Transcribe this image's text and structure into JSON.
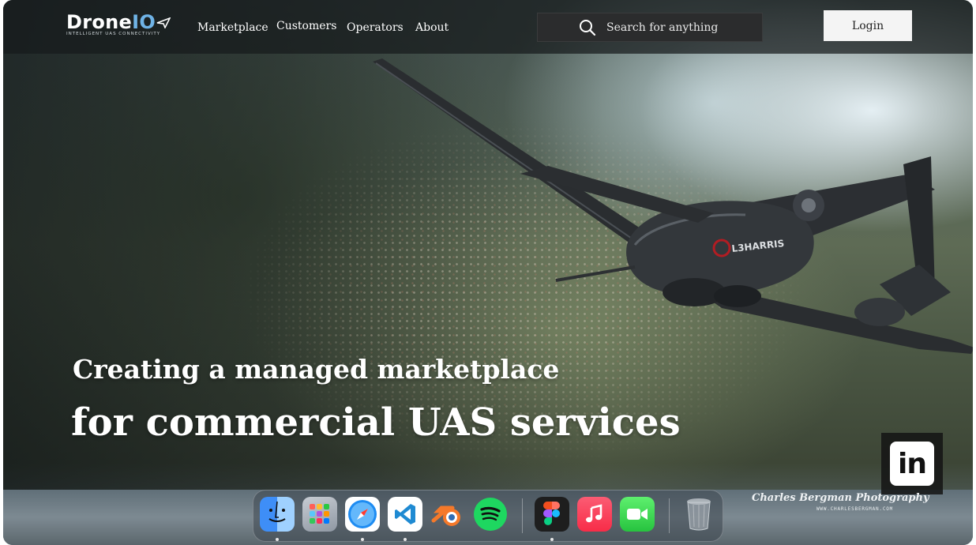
{
  "brand": {
    "name_main": "Drone",
    "name_accent": "IO",
    "tagline": "INTELLIGENT UAS CONNECTIVITY"
  },
  "nav": {
    "links": [
      "Marketplace",
      "Customers",
      "Operators",
      "About"
    ],
    "search_placeholder": "Search for anything",
    "login_label": "Login"
  },
  "hero": {
    "line1": "Creating a managed marketplace",
    "line2": "for commercial UAS services",
    "drone_marking": "L3HARRIS"
  },
  "social": {
    "linkedin_label": "in"
  },
  "photo_credit": {
    "name": "Charles Bergman Photography",
    "url": "WWW.CHARLESBERGMAN.COM"
  },
  "dock": {
    "apps": [
      "finder-icon",
      "launchpad-icon",
      "safari-icon",
      "vscode-icon",
      "blender-icon",
      "spotify-icon",
      "figma-icon",
      "music-icon",
      "facetime-icon",
      "trash-icon"
    ],
    "running": [
      "finder-icon",
      "safari-icon",
      "vscode-icon",
      "figma-icon"
    ]
  },
  "colors": {
    "brand_accent": "#6fb3e6",
    "nav_bg": "#161a1c",
    "search_bg": "#2b2c2d",
    "login_bg": "#f4f4f4"
  }
}
